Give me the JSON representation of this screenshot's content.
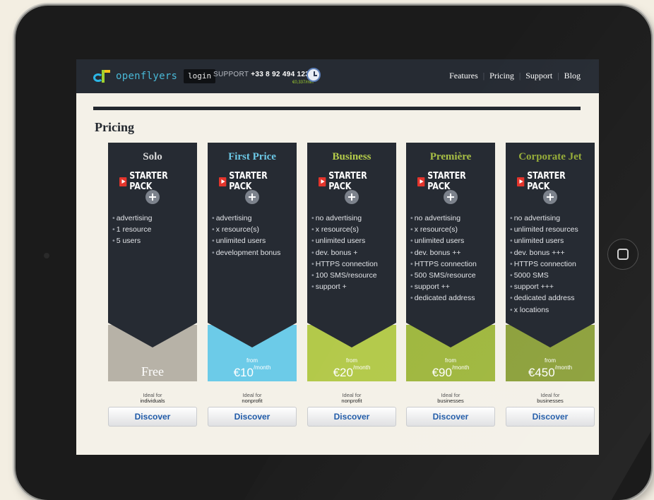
{
  "header": {
    "logo_text": "openflyers",
    "login_label": "login",
    "support_label": "SUPPORT",
    "support_phone": "+33 8 92 494 123",
    "support_rate": "€0,337/min",
    "nav": [
      "Features",
      "Pricing",
      "Support",
      "Blog"
    ]
  },
  "page": {
    "title": "Pricing"
  },
  "plans": [
    {
      "name": "Solo",
      "name_color": "#d9d9d9",
      "starter": "STARTER PACK",
      "features": [
        "advertising",
        "1 resource",
        "5 users"
      ],
      "price_color": "#b7b2a7",
      "price": "Free",
      "ideal_label": "Ideal for",
      "ideal_target": "individuals",
      "discover": "Discover"
    },
    {
      "name": "First Price",
      "name_color": "#6cc8e6",
      "starter": "STARTER PACK",
      "features": [
        "advertising",
        "x resource(s)",
        "unlimited users",
        "development bonus"
      ],
      "price_color": "#6ccbe8",
      "from": "from",
      "price": "€10",
      "period": "/month",
      "ideal_label": "Ideal for",
      "ideal_target": "nonprofit",
      "discover": "Discover"
    },
    {
      "name": "Business",
      "name_color": "#b5cc4a",
      "starter": "STARTER PACK",
      "features": [
        "no advertising",
        "x resource(s)",
        "unlimited users",
        "dev. bonus +",
        "HTTPS connection",
        "100 SMS/resource",
        "support +"
      ],
      "price_color": "#b3c94a",
      "from": "from",
      "price": "€20",
      "period": "/month",
      "ideal_label": "Ideal for",
      "ideal_target": "nonprofit",
      "discover": "Discover"
    },
    {
      "name": "Première",
      "name_color": "#a8bf45",
      "starter": "STARTER PACK",
      "features": [
        "no advertising",
        "x resource(s)",
        "unlimited users",
        "dev. bonus ++",
        "HTTPS connection",
        "500 SMS/resource",
        "support ++",
        "dedicated address"
      ],
      "price_color": "#9fb73e",
      "from": "from",
      "price": "€90",
      "period": "/month",
      "ideal_label": "Ideal for",
      "ideal_target": "businesses",
      "discover": "Discover"
    },
    {
      "name": "Corporate Jet",
      "name_color": "#97ad3a",
      "starter": "STARTER PACK",
      "features": [
        "no advertising",
        "unlimited resources",
        "unlimited users",
        "dev. bonus +++",
        "HTTPS connection",
        "5000 SMS",
        "support +++",
        "dedicated address",
        "x locations"
      ],
      "price_color": "#8ca03a",
      "from": "from",
      "price": "€450",
      "period": "/month",
      "ideal_label": "Ideal for",
      "ideal_target": "businesses",
      "discover": "Discover"
    }
  ]
}
